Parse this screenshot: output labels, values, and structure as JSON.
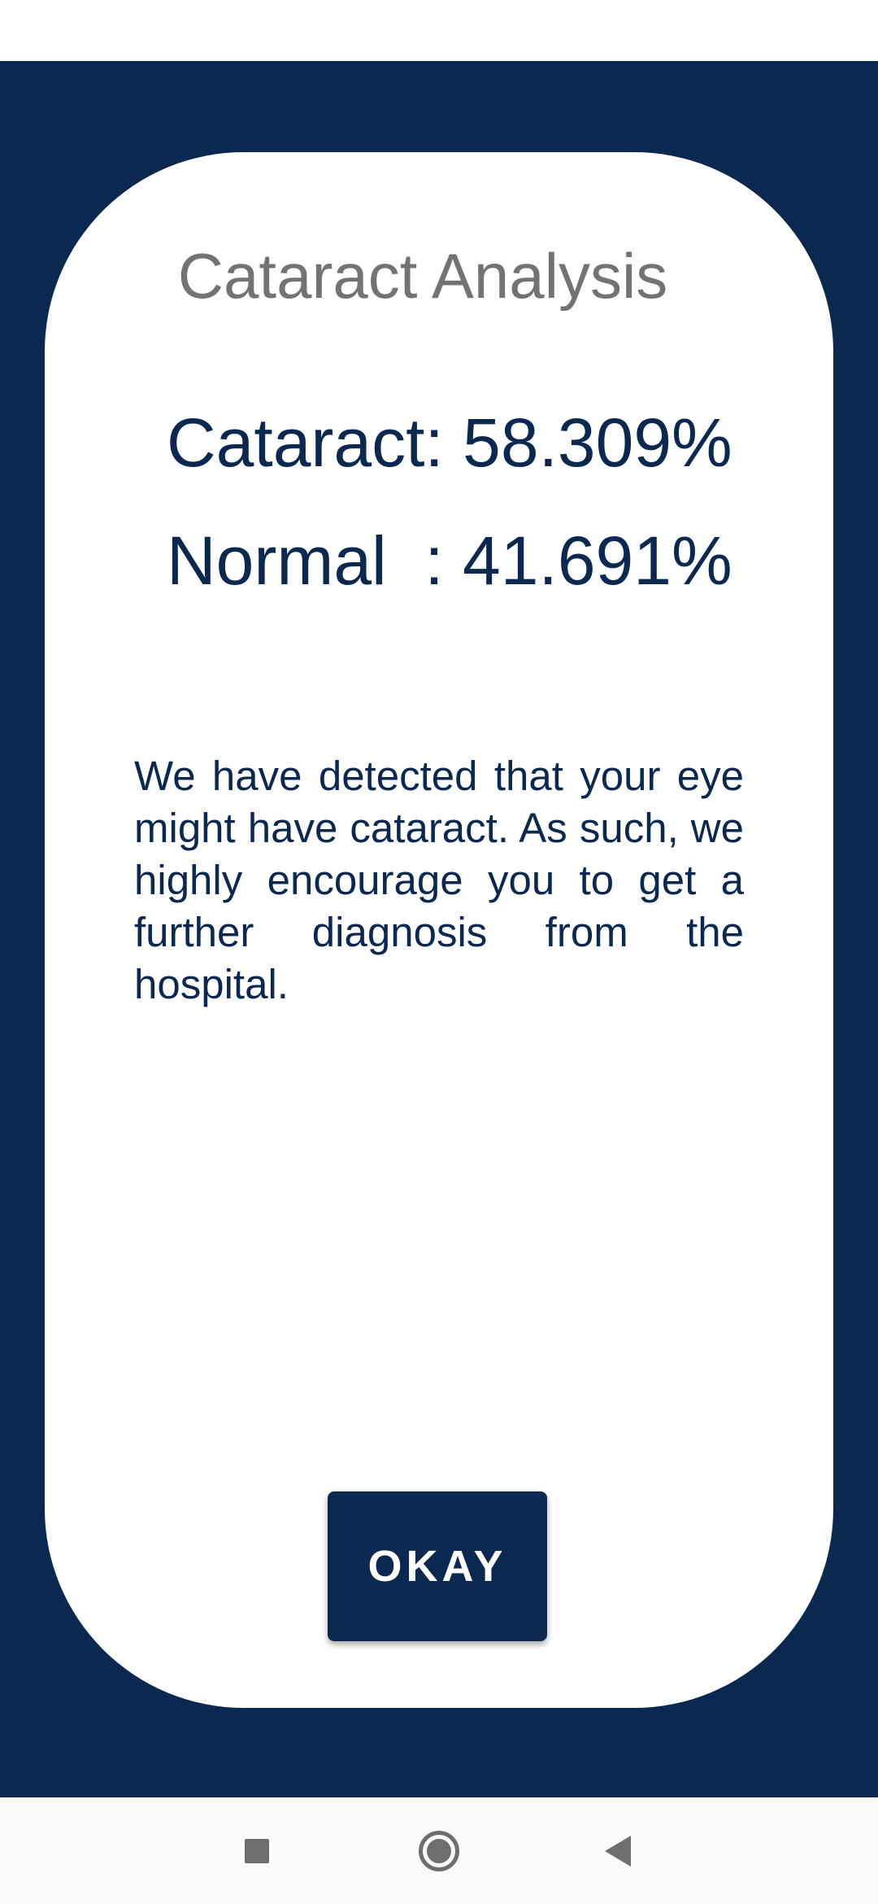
{
  "dialog": {
    "title": "Cataract Analysis",
    "cataract_result": "Cataract: 58.309%",
    "normal_result": "Normal  : 41.691%",
    "message": "We have detected that your eye might have cataract. As such, we highly encourage you to get a further diagnosis from the hospital.",
    "okay_label": "OKAY"
  },
  "navigation": {
    "recents_icon": "square-icon",
    "home_icon": "circle-icon",
    "back_icon": "triangle-back-icon"
  },
  "colors": {
    "primary": "#0a2850",
    "title_gray": "#737373",
    "card_bg": "#ffffff"
  }
}
